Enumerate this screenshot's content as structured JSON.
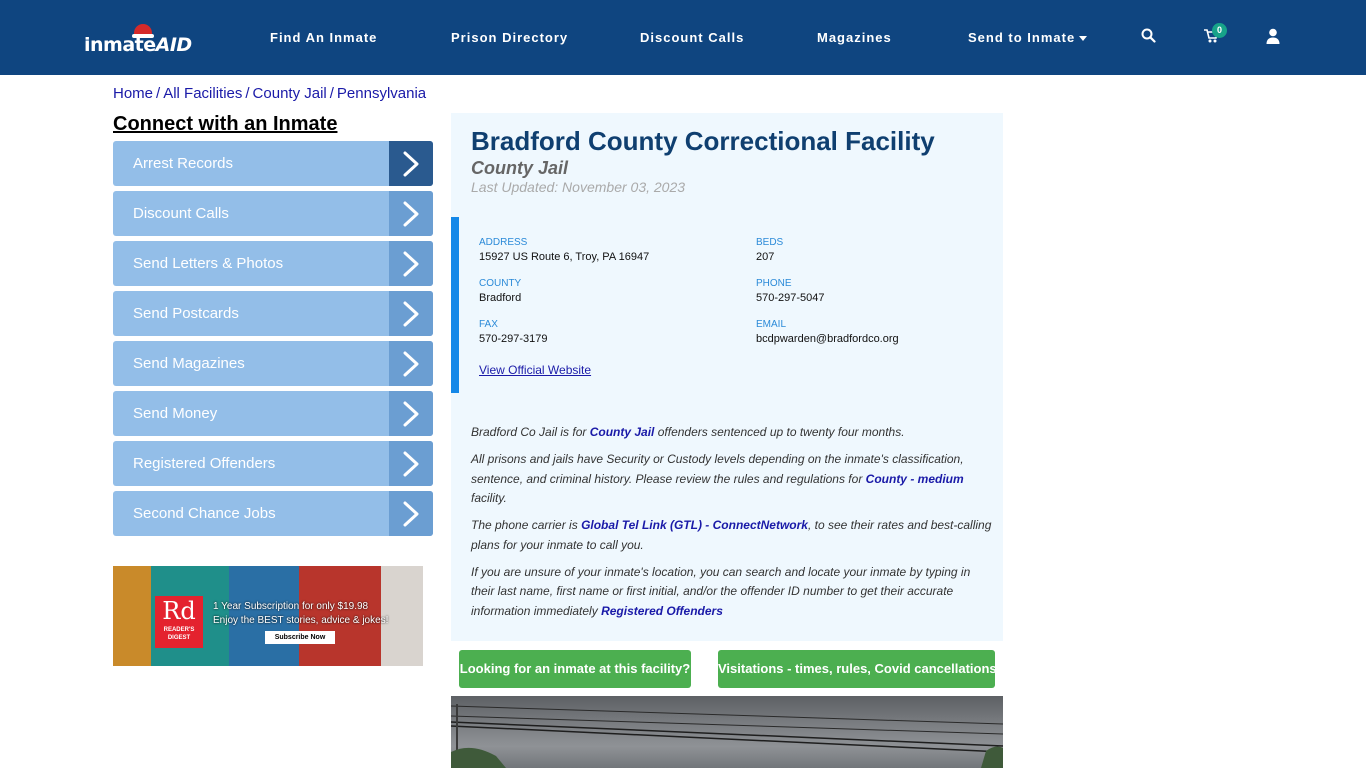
{
  "header": {
    "logo": {
      "text_main": "inmate",
      "text_accent": "AID"
    },
    "nav": [
      {
        "label": "Find An Inmate"
      },
      {
        "label": "Prison Directory"
      },
      {
        "label": "Discount Calls"
      },
      {
        "label": "Magazines"
      },
      {
        "label": "Send to Inmate",
        "has_dropdown": true
      }
    ],
    "icons": {
      "search": "search-icon",
      "cart": "cart-icon",
      "user": "user-icon"
    },
    "cart_count": "0"
  },
  "breadcrumb": [
    {
      "label": "Home"
    },
    {
      "label": "All Facilities"
    },
    {
      "label": "County Jail"
    },
    {
      "label": "Pennsylvania"
    }
  ],
  "breadcrumb_separator": "/",
  "sidebar": {
    "title": "Connect with an Inmate",
    "items": [
      {
        "label": "Arrest Records"
      },
      {
        "label": "Discount Calls"
      },
      {
        "label": "Send Letters & Photos"
      },
      {
        "label": "Send Postcards"
      },
      {
        "label": "Send Magazines"
      },
      {
        "label": "Send Money"
      },
      {
        "label": "Registered Offenders"
      },
      {
        "label": "Second Chance Jobs"
      }
    ],
    "ad": {
      "brand_big": "Rd",
      "brand_small": "READER'S DIGEST",
      "line1": "1 Year Subscription for only $19.98",
      "line2": "Enjoy the BEST stories, advice & jokes!",
      "cta": "Subscribe Now"
    }
  },
  "facility": {
    "name": "Bradford County Correctional Facility",
    "type": "County Jail",
    "last_updated": "Last Updated: November 03, 2023",
    "info": {
      "address_label": "ADDRESS",
      "address": "15927 US Route 6, Troy, PA 16947",
      "beds_label": "BEDS",
      "beds": "207",
      "county_label": "COUNTY",
      "county": "Bradford",
      "phone_label": "PHONE",
      "phone": "570-297-5047",
      "fax_label": "FAX",
      "fax": "570-297-3179",
      "email_label": "EMAIL",
      "email": "bcdpwarden@bradfordco.org",
      "website_link": "View Official Website"
    },
    "description": {
      "p1_a": "Bradford Co Jail is for ",
      "p1_link": "County Jail",
      "p1_b": " offenders sentenced up to twenty four months.",
      "p2_a": "All prisons and jails have Security or Custody levels depending on the inmate's classification, sentence, and criminal history. Please review the rules and regulations for ",
      "p2_link": "County - medium",
      "p2_b": " facility.",
      "p3_a": "The phone carrier is ",
      "p3_link": "Global Tel Link (GTL) - ConnectNetwork",
      "p3_b": ", to see their rates and best-calling plans for your inmate to call you.",
      "p4_a": "If you are unsure of your inmate's location, you can search and locate your inmate by typing in their last name, first name or first initial, and/or the offender ID number to get their accurate information immediately ",
      "p4_link": "Registered Offenders"
    },
    "buttons": {
      "find_inmate": "Looking for an inmate at this facility?",
      "visitations": "Visitations - times, rules, Covid cancellations"
    }
  },
  "colors": {
    "nav_bg": "#0f4580",
    "side_item": "#93bee8",
    "side_arrow": "#6b9ed2",
    "side_arrow_active": "#2a5a8f",
    "title": "#0f3f70",
    "accent_bar": "#1588e8",
    "green_button": "#4caf50",
    "link": "#1a1aa8"
  }
}
